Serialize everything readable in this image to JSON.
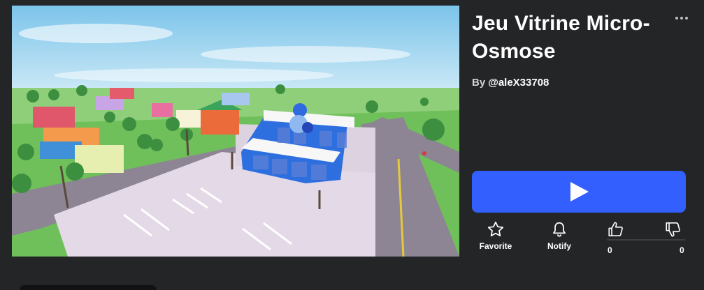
{
  "game": {
    "title": "Jeu Vitrine Micro-Osmose",
    "by_label": "By",
    "creator": "@aleX33708"
  },
  "actions": {
    "favorite_label": "Favorite",
    "notify_label": "Notify"
  },
  "votes": {
    "up_count": "0",
    "down_count": "0"
  },
  "icons": {
    "more": "more-options-icon",
    "play": "play-icon",
    "favorite": "star-icon",
    "notify": "bell-icon",
    "upvote": "thumbs-up-icon",
    "downvote": "thumbs-down-icon"
  },
  "colors": {
    "background": "#232527",
    "play_button": "#335fff",
    "text": "#ffffff"
  }
}
